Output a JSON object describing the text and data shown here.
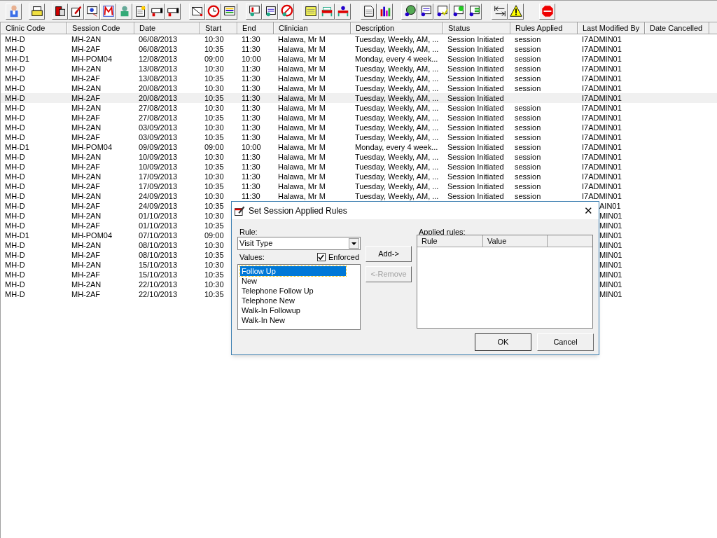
{
  "table": {
    "columns": [
      "Clinic Code",
      "Session Code",
      "Date",
      "Start",
      "End",
      "Clinician",
      "Description",
      "Status",
      "Rules Applied",
      "Last Modified By",
      "Date Cancelled"
    ],
    "rows": [
      {
        "clinic_code": "MH-D",
        "session_code": "MH-2AN",
        "date": "06/08/2013",
        "start": "10:30",
        "end": "11:30",
        "clinician": "Halawa, Mr M",
        "description": "Tuesday, Weekly, AM, ...",
        "status": "Session Initiated",
        "rules_applied": "session",
        "last_modified_by": "I7ADMIN01",
        "selected": false
      },
      {
        "clinic_code": "MH-D",
        "session_code": "MH-2AF",
        "date": "06/08/2013",
        "start": "10:35",
        "end": "11:30",
        "clinician": "Halawa, Mr M",
        "description": "Tuesday, Weekly, AM, ...",
        "status": "Session Initiated",
        "rules_applied": "session",
        "last_modified_by": "I7ADMIN01",
        "selected": false
      },
      {
        "clinic_code": "MH-D1",
        "session_code": "MH-POM04",
        "date": "12/08/2013",
        "start": "09:00",
        "end": "10:00",
        "clinician": "Halawa, Mr M",
        "description": "Monday, every 4 week...",
        "status": "Session Initiated",
        "rules_applied": "session",
        "last_modified_by": "I7ADMIN01",
        "selected": false
      },
      {
        "clinic_code": "MH-D",
        "session_code": "MH-2AN",
        "date": "13/08/2013",
        "start": "10:30",
        "end": "11:30",
        "clinician": "Halawa, Mr M",
        "description": "Tuesday, Weekly, AM, ...",
        "status": "Session Initiated",
        "rules_applied": "session",
        "last_modified_by": "I7ADMIN01",
        "selected": false
      },
      {
        "clinic_code": "MH-D",
        "session_code": "MH-2AF",
        "date": "13/08/2013",
        "start": "10:35",
        "end": "11:30",
        "clinician": "Halawa, Mr M",
        "description": "Tuesday, Weekly, AM, ...",
        "status": "Session Initiated",
        "rules_applied": "session",
        "last_modified_by": "I7ADMIN01",
        "selected": false
      },
      {
        "clinic_code": "MH-D",
        "session_code": "MH-2AN",
        "date": "20/08/2013",
        "start": "10:30",
        "end": "11:30",
        "clinician": "Halawa, Mr M",
        "description": "Tuesday, Weekly, AM, ...",
        "status": "Session Initiated",
        "rules_applied": "session",
        "last_modified_by": "I7ADMIN01",
        "selected": false
      },
      {
        "clinic_code": "MH-D",
        "session_code": "MH-2AF",
        "date": "20/08/2013",
        "start": "10:35",
        "end": "11:30",
        "clinician": "Halawa, Mr M",
        "description": "Tuesday, Weekly, AM, ...",
        "status": "Session Initiated",
        "last_modified_by": "I7ADMIN01",
        "selected": true
      },
      {
        "clinic_code": "MH-D",
        "session_code": "MH-2AN",
        "date": "27/08/2013",
        "start": "10:30",
        "end": "11:30",
        "clinician": "Halawa, Mr M",
        "description": "Tuesday, Weekly, AM, ...",
        "status": "Session Initiated",
        "rules_applied": "session",
        "last_modified_by": "I7ADMIN01",
        "selected": false
      },
      {
        "clinic_code": "MH-D",
        "session_code": "MH-2AF",
        "date": "27/08/2013",
        "start": "10:35",
        "end": "11:30",
        "clinician": "Halawa, Mr M",
        "description": "Tuesday, Weekly, AM, ...",
        "status": "Session Initiated",
        "rules_applied": "session",
        "last_modified_by": "I7ADMIN01",
        "selected": false
      },
      {
        "clinic_code": "MH-D",
        "session_code": "MH-2AN",
        "date": "03/09/2013",
        "start": "10:30",
        "end": "11:30",
        "clinician": "Halawa, Mr M",
        "description": "Tuesday, Weekly, AM, ...",
        "status": "Session Initiated",
        "rules_applied": "session",
        "last_modified_by": "I7ADMIN01",
        "selected": false
      },
      {
        "clinic_code": "MH-D",
        "session_code": "MH-2AF",
        "date": "03/09/2013",
        "start": "10:35",
        "end": "11:30",
        "clinician": "Halawa, Mr M",
        "description": "Tuesday, Weekly, AM, ...",
        "status": "Session Initiated",
        "rules_applied": "session",
        "last_modified_by": "I7ADMIN01",
        "selected": false
      },
      {
        "clinic_code": "MH-D1",
        "session_code": "MH-POM04",
        "date": "09/09/2013",
        "start": "09:00",
        "end": "10:00",
        "clinician": "Halawa, Mr M",
        "description": "Monday, every 4 week...",
        "status": "Session Initiated",
        "rules_applied": "session",
        "last_modified_by": "I7ADMIN01",
        "selected": false
      },
      {
        "clinic_code": "MH-D",
        "session_code": "MH-2AN",
        "date": "10/09/2013",
        "start": "10:30",
        "end": "11:30",
        "clinician": "Halawa, Mr M",
        "description": "Tuesday, Weekly, AM, ...",
        "status": "Session Initiated",
        "rules_applied": "session",
        "last_modified_by": "I7ADMIN01",
        "selected": false
      },
      {
        "clinic_code": "MH-D",
        "session_code": "MH-2AF",
        "date": "10/09/2013",
        "start": "10:35",
        "end": "11:30",
        "clinician": "Halawa, Mr M",
        "description": "Tuesday, Weekly, AM, ...",
        "status": "Session Initiated",
        "rules_applied": "session",
        "last_modified_by": "I7ADMIN01",
        "selected": false
      },
      {
        "clinic_code": "MH-D",
        "session_code": "MH-2AN",
        "date": "17/09/2013",
        "start": "10:30",
        "end": "11:30",
        "clinician": "Halawa, Mr M",
        "description": "Tuesday, Weekly, AM, ...",
        "status": "Session Initiated",
        "rules_applied": "session",
        "last_modified_by": "I7ADMIN01",
        "selected": false
      },
      {
        "clinic_code": "MH-D",
        "session_code": "MH-2AF",
        "date": "17/09/2013",
        "start": "10:35",
        "end": "11:30",
        "clinician": "Halawa, Mr M",
        "description": "Tuesday, Weekly, AM, ...",
        "status": "Session Initiated",
        "rules_applied": "session",
        "last_modified_by": "I7ADMIN01",
        "selected": false
      },
      {
        "clinic_code": "MH-D",
        "session_code": "MH-2AN",
        "date": "24/09/2013",
        "start": "10:30",
        "end": "11:30",
        "clinician": "Halawa, Mr M",
        "description": "Tuesday, Weekly, AM, ...",
        "status": "Session Initiated",
        "rules_applied": "session",
        "last_modified_by": "I7ADMIN01",
        "selected": false
      },
      {
        "clinic_code": "MH-D",
        "session_code": "MH-2AF",
        "date": "24/09/2013",
        "start": "10:35",
        "last_modified_by": "AIN01",
        "selected": false
      },
      {
        "clinic_code": "MH-D",
        "session_code": "MH-2AN",
        "date": "01/10/2013",
        "start": "10:30",
        "last_modified_by": "MIN01",
        "selected": false
      },
      {
        "clinic_code": "MH-D",
        "session_code": "MH-2AF",
        "date": "01/10/2013",
        "start": "10:35",
        "last_modified_by": "MIN01",
        "selected": false
      },
      {
        "clinic_code": "MH-D1",
        "session_code": "MH-POM04",
        "date": "07/10/2013",
        "start": "09:00",
        "last_modified_by": "MIN01",
        "selected": false
      },
      {
        "clinic_code": "MH-D",
        "session_code": "MH-2AN",
        "date": "08/10/2013",
        "start": "10:30",
        "last_modified_by": "MIN01",
        "selected": false
      },
      {
        "clinic_code": "MH-D",
        "session_code": "MH-2AF",
        "date": "08/10/2013",
        "start": "10:35",
        "last_modified_by": "MIN01",
        "selected": false
      },
      {
        "clinic_code": "MH-D",
        "session_code": "MH-2AN",
        "date": "15/10/2013",
        "start": "10:30",
        "last_modified_by": "MIN01",
        "selected": false
      },
      {
        "clinic_code": "MH-D",
        "session_code": "MH-2AF",
        "date": "15/10/2013",
        "start": "10:35",
        "last_modified_by": "MIN01",
        "selected": false
      },
      {
        "clinic_code": "MH-D",
        "session_code": "MH-2AN",
        "date": "22/10/2013",
        "start": "10:30",
        "last_modified_by": "MIN01",
        "selected": false
      },
      {
        "clinic_code": "MH-D",
        "session_code": "MH-2AF",
        "date": "22/10/2013",
        "start": "10:35",
        "last_modified_by": "MIN01",
        "selected": false
      }
    ]
  },
  "dialog": {
    "title": "Set Session Applied Rules",
    "close": "✕",
    "rule_label": "Rule:",
    "rule_value": "Visit Type",
    "values_label": "Values:",
    "enforced": {
      "label": "Enforced",
      "checked": true
    },
    "values": [
      {
        "label": "Follow Up",
        "selected": true
      },
      {
        "label": "New",
        "selected": false
      },
      {
        "label": "Telephone Follow Up",
        "selected": false
      },
      {
        "label": "Telephone New",
        "selected": false
      },
      {
        "label": "Walk-In Followup",
        "selected": false
      },
      {
        "label": "Walk-In New",
        "selected": false
      }
    ],
    "add_button": {
      "label": "Add->",
      "disabled": false
    },
    "remove_button": {
      "label": "<-Remove",
      "disabled": true
    },
    "applied_label": "Applied rules:",
    "applied_columns": [
      "Rule",
      "Value"
    ],
    "ok": "OK",
    "cancel": "Cancel"
  }
}
